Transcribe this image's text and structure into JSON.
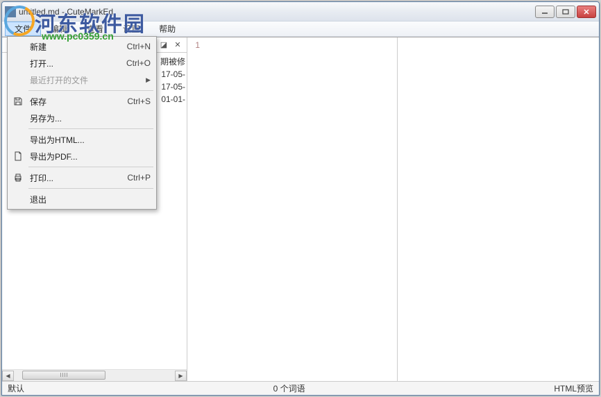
{
  "title": "untitled.md - CuteMarkEd",
  "menubar": {
    "file": "文件",
    "edit": "编辑",
    "view": "查看",
    "settings": "设置",
    "help": "帮助"
  },
  "dropdown": {
    "new": "新建",
    "new_sc": "Ctrl+N",
    "open": "打开...",
    "open_sc": "Ctrl+O",
    "recent": "最近打开的文件",
    "save": "保存",
    "save_sc": "Ctrl+S",
    "saveas": "另存为...",
    "export_html": "导出为HTML...",
    "export_pdf": "导出为PDF...",
    "print": "打印...",
    "print_sc": "Ctrl+P",
    "exit": "退出"
  },
  "left_header_col": "期被修",
  "rows": {
    "r1": "17-05-",
    "r2": "17-05-",
    "r3": "01-01-"
  },
  "gutter_line": "1",
  "status": {
    "left": "默认",
    "center": "0 个词语",
    "right": "HTML预览"
  },
  "watermark": {
    "text": "河东软件园",
    "url": "www.pc0359.cn"
  }
}
